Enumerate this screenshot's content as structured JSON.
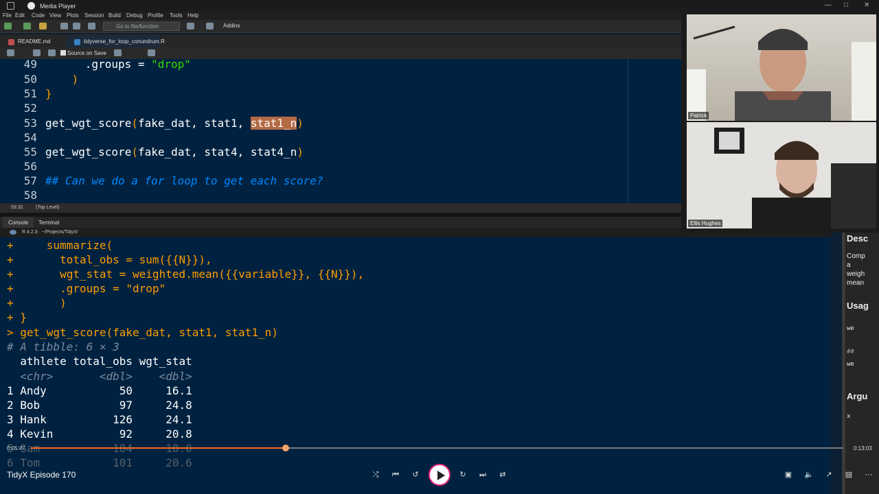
{
  "window": {
    "title": "Media Player"
  },
  "menu": [
    "File",
    "Edit",
    "Code",
    "View",
    "Plots",
    "Session",
    "Build",
    "Debug",
    "Profile",
    "Tools",
    "Help"
  ],
  "toolbar": {
    "goto_placeholder": "Go to file/function",
    "addins_label": "Addins"
  },
  "tabs": [
    {
      "label": "README.md"
    },
    {
      "label": "tidyverse_for_loop_conundrum.R",
      "active": true
    }
  ],
  "editor_toolbar": {
    "source_on_save": "Source on Save"
  },
  "editor": {
    "lines": [
      {
        "n": "49",
        "text": "      .groups = \"drop\""
      },
      {
        "n": "50",
        "text": "    )"
      },
      {
        "n": "51",
        "text": "}"
      },
      {
        "n": "52",
        "text": ""
      },
      {
        "n": "53",
        "text": "get_wgt_score(fake_dat, stat1, stat1_n)"
      },
      {
        "n": "54",
        "text": ""
      },
      {
        "n": "55",
        "text": "get_wgt_score(fake_dat, stat4, stat4_n)"
      },
      {
        "n": "56",
        "text": ""
      },
      {
        "n": "57",
        "text": "## Can we do a for loop to get each score?"
      },
      {
        "n": "58",
        "text": ""
      }
    ],
    "selection": "stat1_n"
  },
  "status": {
    "position": "53:32",
    "scope": "(Top Level)"
  },
  "console_tabs": [
    "Console",
    "Terminal"
  ],
  "console_path": "R 4.2.3 · ~/Projects/TidyX/",
  "console": {
    "lines": [
      {
        "text": "+     summarize(",
        "cls": ""
      },
      {
        "text": "+       total_obs = sum({{N}}),",
        "cls": ""
      },
      {
        "text": "+       wgt_stat = weighted.mean({{variable}}, {{N}}),",
        "cls": ""
      },
      {
        "text": "+       .groups = \"drop\"",
        "cls": ""
      },
      {
        "text": "+       )",
        "cls": ""
      },
      {
        "text": "+ }",
        "cls": ""
      },
      {
        "text": "> get_wgt_score(fake_dat, stat1, stat1_n)",
        "cls": ""
      },
      {
        "text": "# A tibble: 6 × 3",
        "cls": "dim"
      },
      {
        "text": "  athlete total_obs wgt_stat",
        "cls": "out"
      },
      {
        "text": "  <chr>       <dbl>    <dbl>",
        "cls": "dim"
      },
      {
        "text": "1 Andy           50     16.1",
        "cls": "num"
      },
      {
        "text": "2 Bob            97     24.8",
        "cls": "num"
      },
      {
        "text": "3 Hank          126     24.1",
        "cls": "num"
      },
      {
        "text": "4 Kevin          92     20.8",
        "cls": "num"
      },
      {
        "text": "5 Sam           184     18.0",
        "cls": "faded"
      },
      {
        "text": "6 Tom           101     20.6",
        "cls": "faded"
      }
    ]
  },
  "help": {
    "desc_heading": "Desc",
    "desc_lines": [
      "Comp",
      "a",
      "weigh",
      "mean"
    ],
    "usage_heading": "Usag",
    "usage_lines": [
      "we",
      "##",
      "we"
    ],
    "args_heading": "Argu",
    "arg_x": "x"
  },
  "participants": [
    {
      "name": "Patrick"
    },
    {
      "name": "Ellis Hughes"
    }
  ],
  "player": {
    "current_time": "0:05:47",
    "total_time": "0:13:03",
    "progress": 0.314,
    "episode_title": "TidyX Episode 170"
  },
  "colors": {
    "accent": "#f36d21",
    "play_ring": "#e8277a"
  }
}
